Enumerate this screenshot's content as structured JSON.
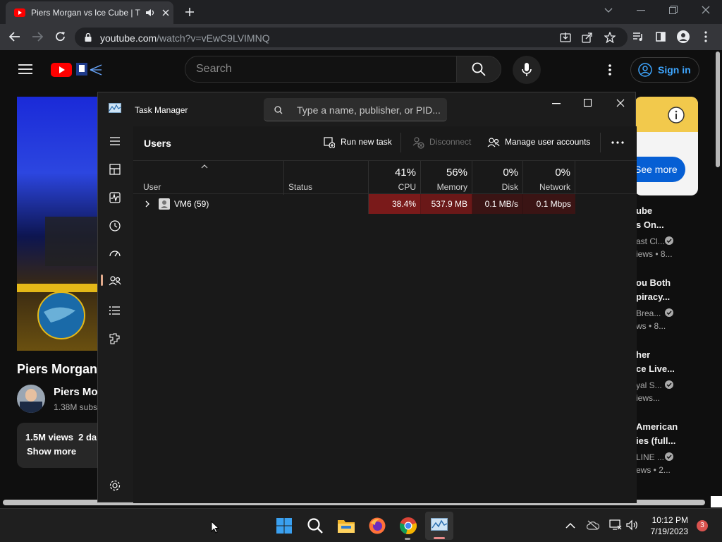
{
  "browser": {
    "tab_title": "Piers Morgan vs Ice Cube | T",
    "url_host": "youtube.com",
    "url_path": "/watch?v=vEwC9LVIMNQ"
  },
  "youtube": {
    "search_placeholder": "Search",
    "sign_in_label": "Sign in",
    "video_title": "Piers Morgan",
    "channel_name": "Piers Mo",
    "subscribers": "1.38M subs",
    "views": "1.5M views  2 da",
    "show_more": "Show more",
    "ad_button": "See more",
    "recommendations": [
      {
        "title1": "ube",
        "title2": "s On...",
        "channel": "ast Cl...",
        "meta": "iews  • 8..."
      },
      {
        "title1": "ou Both",
        "title2": "piracy...",
        "channel": "Brea...",
        "meta": "ws  • 8..."
      },
      {
        "title1": "her",
        "title2": "ce Live...",
        "channel": "yal S...",
        "meta": "iews..."
      },
      {
        "title1": "American",
        "title2": "ies (full...",
        "channel": "LINE ...",
        "meta": "ews  • 2..."
      }
    ]
  },
  "task_manager": {
    "window_title": "Task Manager",
    "search_placeholder": "Type a name, publisher, or PID...",
    "page_title": "Users",
    "commands": {
      "run_new_task": "Run new task",
      "disconnect": "Disconnect",
      "manage_user_accounts": "Manage user accounts"
    },
    "columns": {
      "user": "User",
      "status": "Status",
      "cpu_pct": "41%",
      "cpu": "CPU",
      "memory_pct": "56%",
      "memory": "Memory",
      "disk_pct": "0%",
      "disk": "Disk",
      "network_pct": "0%",
      "network": "Network"
    },
    "rows": [
      {
        "user": "VM6 (59)",
        "status": "",
        "cpu": "38.4%",
        "memory": "537.9 MB",
        "disk": "0.1 MB/s",
        "network": "0.1 Mbps"
      }
    ],
    "nav_items": [
      "Processes",
      "Performance",
      "App history",
      "Startup apps",
      "Users",
      "Details",
      "Services",
      "Settings"
    ],
    "colors": {
      "cpu_heat": "#7a1a1a",
      "memory_heat": "#6a1818",
      "disk_heat": "#3a1414",
      "accent": "#e0a98b"
    }
  },
  "taskbar": {
    "time": "10:12 PM",
    "date": "7/19/2023",
    "notification_count": "3",
    "apps": [
      "start-icon",
      "search-icon",
      "file-explorer-icon",
      "firefox-icon",
      "chrome-icon",
      "task-manager-icon"
    ]
  }
}
